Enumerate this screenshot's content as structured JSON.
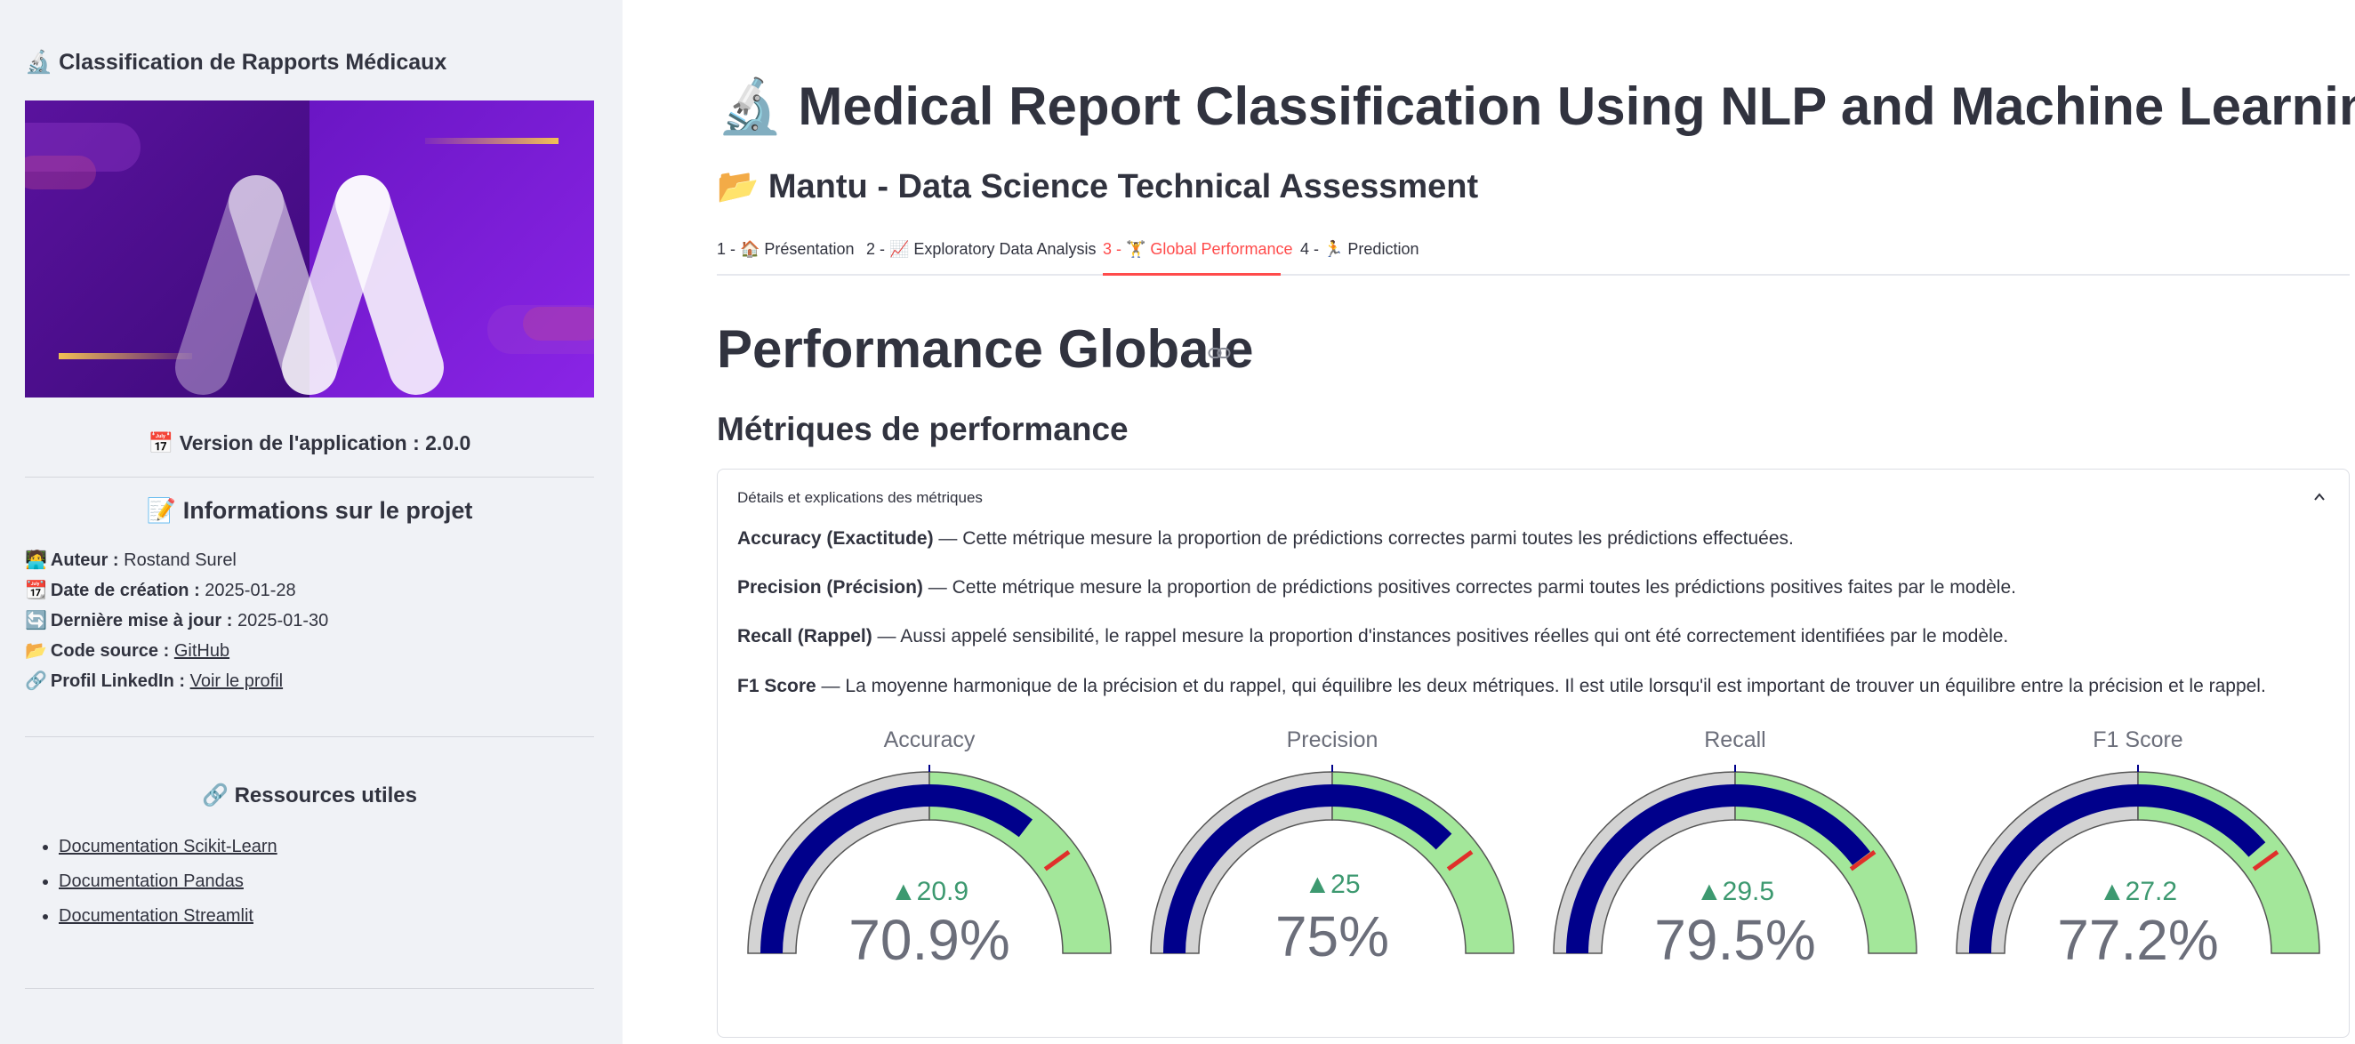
{
  "sidebar": {
    "title": "Classification de Rapports Médicaux",
    "version": "Version de l'application : 2.0.0",
    "project_title": "Informations sur le projet",
    "info": [
      {
        "label": "Auteur :",
        "value": "Rostand Surel"
      },
      {
        "label": "Date de création :",
        "value": "2025-01-28"
      },
      {
        "label": "Dernière mise à jour :",
        "value": "2025-01-30"
      },
      {
        "label": "Code source :",
        "value": "GitHub"
      },
      {
        "label": "Profil LinkedIn :",
        "value": "Voir le profil"
      }
    ],
    "resources_title": "Ressources utiles",
    "resources": [
      "Documentation Scikit-Learn",
      "Documentation Pandas",
      "Documentation Streamlit"
    ]
  },
  "main": {
    "title": "Medical Report Classification Using NLP and Machine Learning",
    "subtitle": "Mantu - Data Science Technical Assessment",
    "tabs": [
      {
        "label": "1 - 🏠 Présentation"
      },
      {
        "label": "2 - 📈 Exploratory Data Analysis"
      },
      {
        "label": "3 - 🏋 Global Performance"
      },
      {
        "label": "4 - 🏃 Prediction"
      }
    ],
    "active_tab": 2,
    "section_title": "Performance Globale",
    "metrics_title": "Métriques de performance",
    "expander": {
      "header": "Détails et explications des métriques",
      "items": [
        {
          "term": "Accuracy (Exactitude)",
          "text": " — Cette métrique mesure la proportion de prédictions correctes parmi toutes les prédictions effectuées."
        },
        {
          "term": "Precision (Précision)",
          "text": " — Cette métrique mesure la proportion de prédictions positives correctes parmi toutes les prédictions positives faites par le modèle."
        },
        {
          "term": "Recall (Rappel)",
          "text": " — Aussi appelé sensibilité, le rappel mesure la proportion d'instances positives réelles qui ont été correctement identifiées par le modèle."
        },
        {
          "term": "F1 Score",
          "text": " — La moyenne harmonique de la précision et du rappel, qui équilibre les deux métriques. Il est utile lorsqu'il est important de trouver un équilibre entre la précision et le rappel."
        }
      ]
    },
    "gauges": [
      {
        "title": "Accuracy",
        "value": 70.9,
        "value_label": "70.9%",
        "delta_label": "▲20.9",
        "threshold": 80,
        "mid_tick": "50"
      },
      {
        "title": "Precision",
        "value": 75,
        "value_label": "75%",
        "delta_label": "▲25",
        "threshold": 80,
        "mid_tick": "50"
      },
      {
        "title": "Recall",
        "value": 79.5,
        "value_label": "79.5%",
        "delta_label": "▲29.5",
        "threshold": 80,
        "mid_tick": "50"
      },
      {
        "title": "F1 Score",
        "value": 77.2,
        "value_label": "77.2%",
        "delta_label": "▲27.2",
        "threshold": 80,
        "mid_tick": "50"
      }
    ],
    "gauge_range": [
      0,
      100
    ],
    "colors": {
      "bar": "#00008b",
      "low_band": "#d3d3d3",
      "high_band": "#a3e79a",
      "threshold": "#e0302a",
      "delta": "#3d9970"
    }
  }
}
